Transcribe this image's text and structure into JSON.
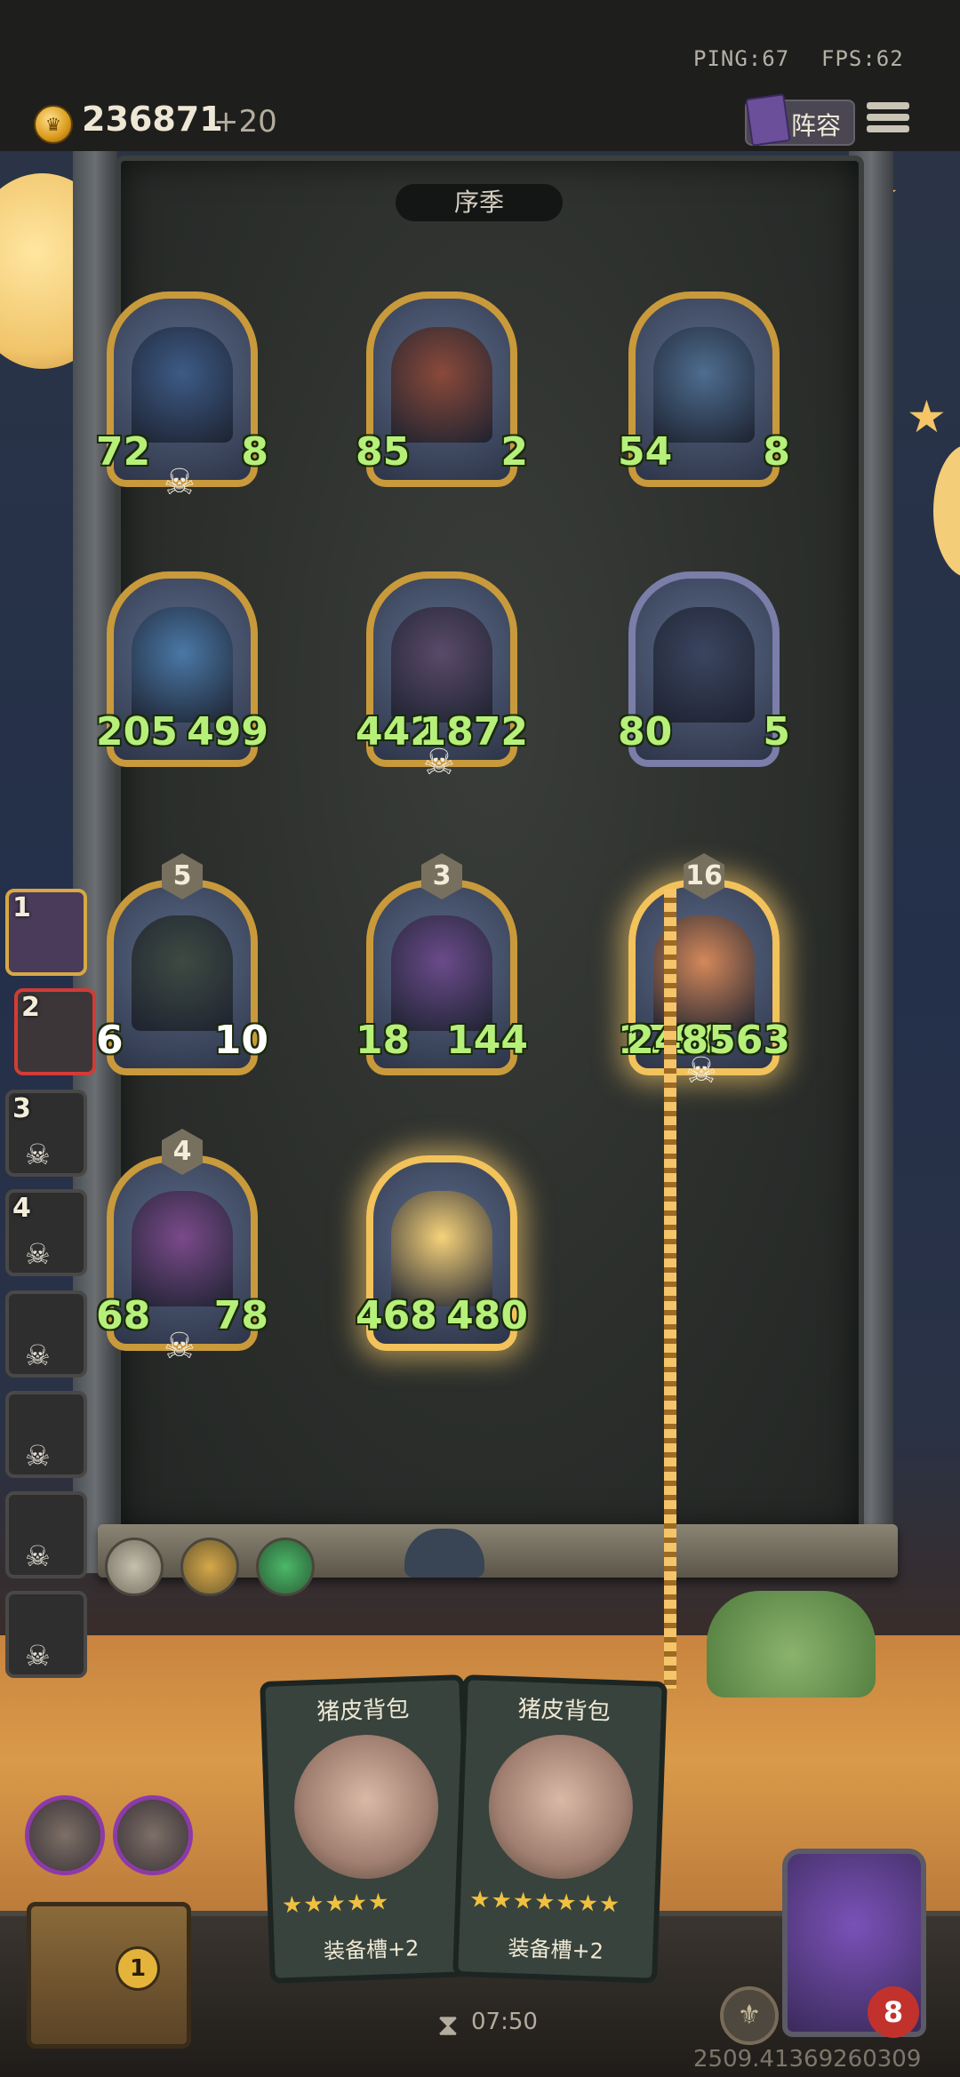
{
  "network": {
    "ping": "PING:67",
    "fps": "FPS:62"
  },
  "currency": {
    "amount": "236871",
    "bonus": "+20",
    "icon": "crown-coin-icon"
  },
  "header": {
    "lineup_label": "阵容",
    "menu_icon": "hamburger-menu-icon"
  },
  "season": {
    "label": "序季"
  },
  "board": {
    "units": [
      {
        "atk": "72",
        "hp": "8",
        "level": "",
        "dead_mark": true
      },
      {
        "atk": "85",
        "hp": "2",
        "level": "",
        "dead_mark": false
      },
      {
        "atk": "54",
        "hp": "8",
        "level": "",
        "dead_mark": false
      },
      {
        "atk": "205",
        "hp": "499",
        "level": "",
        "dead_mark": false
      },
      {
        "atk": "442",
        "hp": "1872",
        "level": "",
        "dead_mark": true
      },
      {
        "atk": "80",
        "hp": "5",
        "level": "",
        "dead_mark": false
      },
      {
        "atk": "6",
        "hp": "10",
        "level": "5",
        "dead_mark": false
      },
      {
        "atk": "18",
        "hp": "144",
        "level": "3",
        "dead_mark": false
      },
      {
        "atk": "1790",
        "hp": "248563",
        "level": "16",
        "dead_mark": true
      },
      {
        "atk": "68",
        "hp": "78",
        "level": "4",
        "dead_mark": true
      },
      {
        "atk": "468",
        "hp": "480",
        "level": "",
        "dead_mark": false
      }
    ]
  },
  "roster": [
    {
      "num": "1",
      "state": "active"
    },
    {
      "num": "2",
      "state": "selected"
    },
    {
      "num": "3",
      "state": "dead"
    },
    {
      "num": "4",
      "state": "dead"
    },
    {
      "num": "",
      "state": "dead"
    },
    {
      "num": "",
      "state": "dead"
    },
    {
      "num": "",
      "state": "dead"
    },
    {
      "num": "",
      "state": "dead"
    }
  ],
  "hand": [
    {
      "title": "猪皮背包",
      "stars": "★★★★★",
      "desc": "装备槽+2"
    },
    {
      "title": "猪皮背包",
      "stars": "★★★★★★★",
      "desc": "装备槽+2"
    }
  ],
  "chest": {
    "count": "1"
  },
  "hero": {
    "hp": "8"
  },
  "timer": "07:50",
  "seed": "2509.41369260309",
  "colors": {
    "gold_frame": "#c99a3b",
    "stat_green": "#b6f07a",
    "selected_red": "#d33b36",
    "hp_red": "#c2322c"
  }
}
